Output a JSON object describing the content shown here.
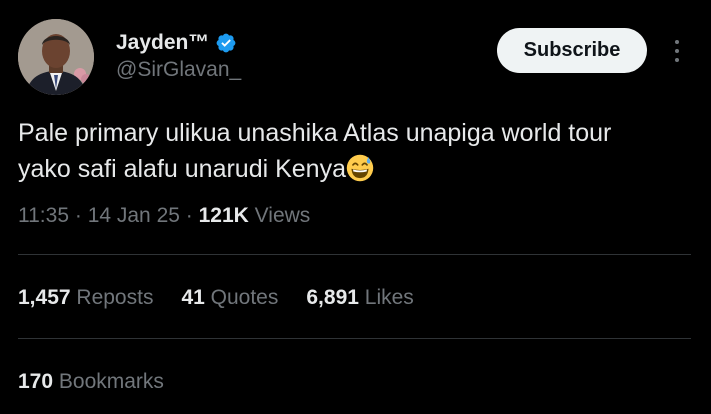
{
  "author": {
    "display_name": "Jayden™",
    "handle": "@SirGlavan_",
    "verified_icon": "verified-badge-icon",
    "verified_color": "#1d9bf0"
  },
  "subscribe_label": "Subscribe",
  "more_icon": "more-vertical-icon",
  "tweet": {
    "line1": "Pale primary ulikua unashika Atlas unapiga world tour",
    "line2": "yako safi alafu unarudi Kenya",
    "emoji": "grinning-sweat-emoji"
  },
  "meta": {
    "time": "11:35",
    "separator": "·",
    "date": "14 Jan 25",
    "views_count": "121K",
    "views_label": "Views"
  },
  "stats": {
    "reposts": {
      "count": "1,457",
      "label": "Reposts"
    },
    "quotes": {
      "count": "41",
      "label": "Quotes"
    },
    "likes": {
      "count": "6,891",
      "label": "Likes"
    },
    "bookmarks": {
      "count": "170",
      "label": "Bookmarks"
    }
  },
  "colors": {
    "background": "#000000",
    "text_primary": "#e7e9ea",
    "text_secondary": "#71767b",
    "divider": "#2f3336",
    "button_bg": "#eff3f4"
  }
}
